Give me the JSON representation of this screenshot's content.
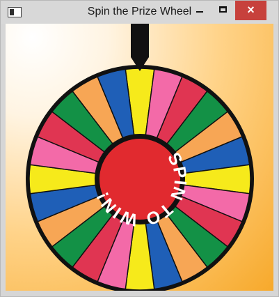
{
  "window": {
    "title": "Spin the Prize Wheel",
    "controls": {
      "minimize": "minimize",
      "maximize": "maximize",
      "close": "×"
    },
    "icon": "app-window-icon"
  },
  "wheel": {
    "segment_colors": [
      "#f6ea1b",
      "#f36aa8",
      "#e03552",
      "#139146",
      "#f7a655",
      "#1f5fb7",
      "#f6ea1b",
      "#f36aa8",
      "#e03552",
      "#139146",
      "#f7a655",
      "#1f5fb7",
      "#f6ea1b",
      "#f36aa8",
      "#e03552",
      "#139146",
      "#f7a655",
      "#1f5fb7",
      "#f6ea1b",
      "#f36aa8",
      "#e03552",
      "#139146",
      "#f7a655",
      "#1f5fb7"
    ],
    "hub_text": "SPIN TO WIN!",
    "pointer_color": "#111111",
    "rim_color": "#111111",
    "hub_color": "#e12a2f",
    "hub_text_color": "#ffffff"
  }
}
